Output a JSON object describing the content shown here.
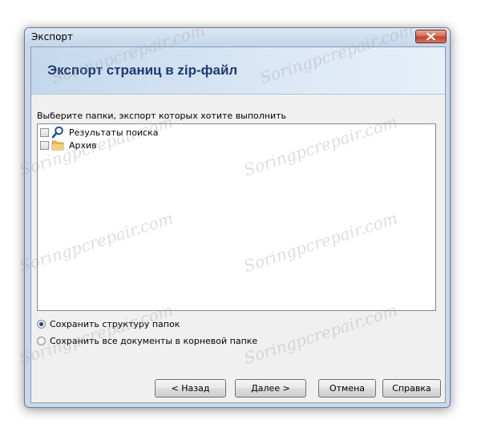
{
  "window": {
    "title": "Экспорт",
    "close_icon": "close-icon"
  },
  "header": {
    "title": "Экспорт страниц в zip-файл"
  },
  "instruction": "Выберите папки, экспорт которых хотите выполнить",
  "folders": [
    {
      "label": "Результаты поиска",
      "checked": false,
      "icon": "search-icon"
    },
    {
      "label": "Архив",
      "checked": false,
      "icon": "folder-icon"
    }
  ],
  "options": [
    {
      "label": "Сохранить структуру папок",
      "selected": true
    },
    {
      "label": "Сохранить все документы в корневой папке",
      "selected": false
    }
  ],
  "buttons": {
    "back": "< Назад",
    "next": "Далее >",
    "cancel": "Отмена",
    "help": "Справка"
  },
  "watermark": "Soringpcrepair.com"
}
